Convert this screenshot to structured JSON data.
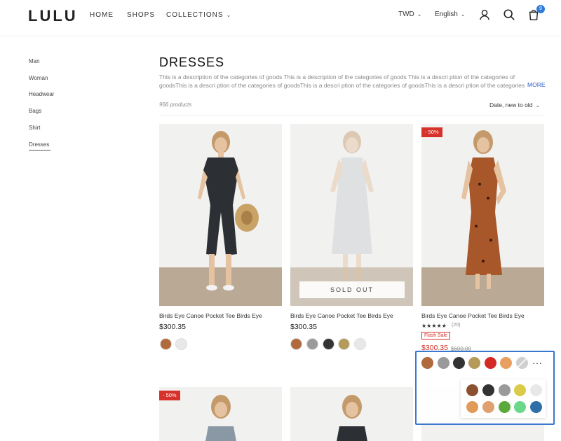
{
  "brand": "LULU",
  "nav": [
    "HOME",
    "SHOPS",
    "COLLECTIONS"
  ],
  "header": {
    "currency": "TWD",
    "language": "English",
    "cart_count": "9"
  },
  "sidebar": [
    "Man",
    "Woman",
    "Headwear",
    "Bags",
    "Shirt",
    "Dresses"
  ],
  "category": {
    "title": "DRESSES",
    "description": "This is a description of the categories of goods This is a description of the categories of goods This is a descri ption of the categories of goodsThis is a descri ption of the categories of goodsThis is a descri ption of the categories of goodsThis is a descri ption of the categories of goods",
    "more": "MORE",
    "count": "966 products",
    "sort": "Date, new to old"
  },
  "products": [
    {
      "name": "Birds Eye Canoe Pocket Tee Birds Eye",
      "price": "$300.35",
      "swatches": [
        "#b06a3b",
        "#e8e8e8"
      ]
    },
    {
      "name": "Birds Eye Canoe Pocket Tee Birds Eye",
      "price": "$300.35",
      "sold_out": "SOLD OUT",
      "swatches": [
        "#b06a3b",
        "#9a9a9a",
        "#333333",
        "#b59a5a",
        "#e8e8e8"
      ]
    },
    {
      "name": "Birds Eye Canoe Pocket Tee Birds Eye",
      "badge": "- 50%",
      "stars": "★★★★★",
      "reviews": "(20)",
      "flash": "Flash Sale",
      "sale_price": "$300.35",
      "old_price": "$600.00"
    }
  ],
  "row2_badge": "- 50%",
  "swatch_panel": {
    "row": [
      "#b06a3b",
      "#9a9a9a",
      "#333333",
      "#b59a5a",
      "#d42a26",
      "#e8a060",
      "#cfcfcf"
    ],
    "more": "···",
    "popup_row1": [
      "#8a5030",
      "#333333",
      "#9a9a9a",
      "#dccb4a",
      "#e8e8e8"
    ],
    "popup_row2": [
      "#e09a5a",
      "#e0a070",
      "#5aaa3a",
      "#6ad88a",
      "#2f6fa8"
    ]
  }
}
